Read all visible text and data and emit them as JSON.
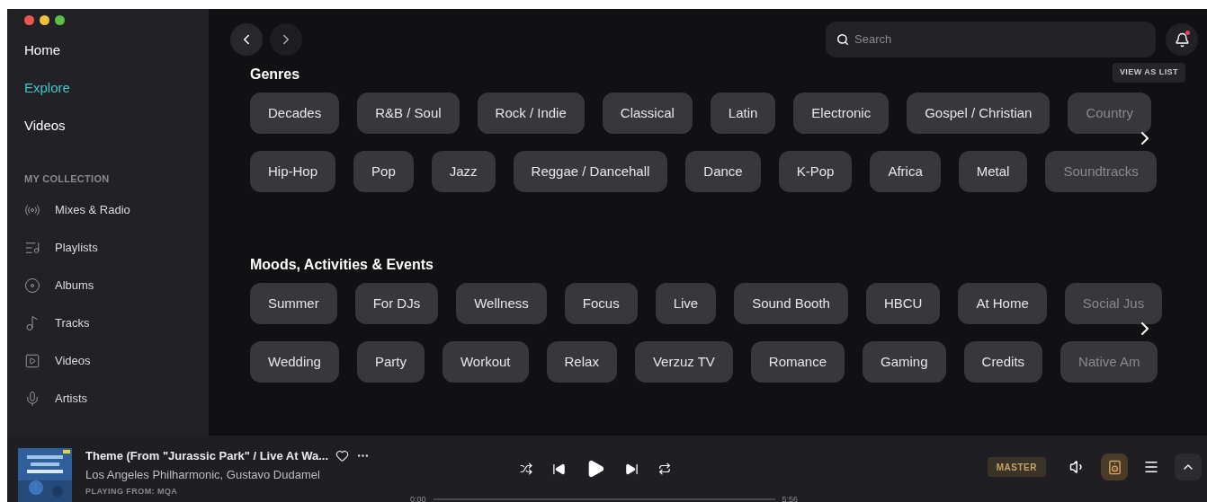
{
  "sidebar": {
    "nav": [
      {
        "label": "Home",
        "selected": false
      },
      {
        "label": "Explore",
        "selected": true
      },
      {
        "label": "Videos",
        "selected": false
      }
    ],
    "section_title": "MY COLLECTION",
    "collection": [
      {
        "label": "Mixes & Radio"
      },
      {
        "label": "Playlists"
      },
      {
        "label": "Albums"
      },
      {
        "label": "Tracks"
      },
      {
        "label": "Videos"
      },
      {
        "label": "Artists"
      }
    ]
  },
  "search": {
    "placeholder": "Search"
  },
  "notifications": {
    "unread": true
  },
  "view_as_list": "VIEW AS LIST",
  "sections": [
    {
      "title": "Genres",
      "rows": [
        {
          "chips": [
            "Decades",
            "R&B / Soul",
            "Rock / Indie",
            "Classical",
            "Latin",
            "Electronic",
            "Gospel / Christian",
            "Country"
          ]
        },
        {
          "chips": [
            "Hip-Hop",
            "Pop",
            "Jazz",
            "Reggae / Dancehall",
            "Dance",
            "K-Pop",
            "Africa",
            "Metal",
            "Soundtracks"
          ]
        }
      ]
    },
    {
      "title": "Moods, Activities & Events",
      "rows": [
        {
          "chips": [
            "Summer",
            "For DJs",
            "Wellness",
            "Focus",
            "Live",
            "Sound Booth",
            "HBCU",
            "At Home",
            "Social Jus"
          ]
        },
        {
          "chips": [
            "Wedding",
            "Party",
            "Workout",
            "Relax",
            "Verzuz TV",
            "Romance",
            "Gaming",
            "Credits",
            "Native Am"
          ]
        }
      ]
    }
  ],
  "player": {
    "title": "Theme (From \"Jurassic Park\" / Live At Wa...",
    "artists": "Los Angeles Philharmonic,  Gustavo Dudamel",
    "source": "PLAYING FROM: MQA",
    "liked": false,
    "elapsed": "0:00",
    "duration": "5:56",
    "level": 0.0,
    "quality": "MASTER",
    "output_active": true
  }
}
